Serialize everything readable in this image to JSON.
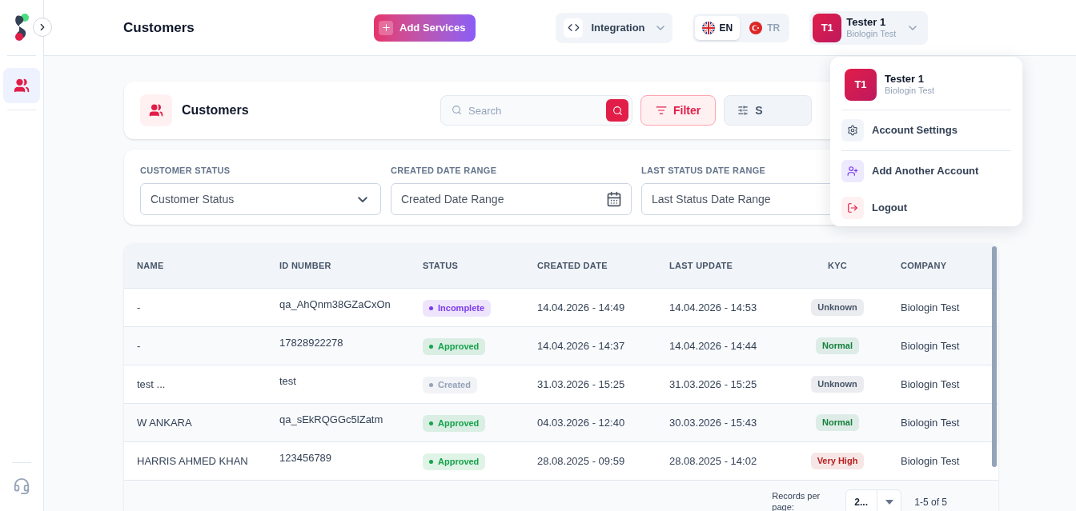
{
  "header": {
    "title": "Customers",
    "add_services": "Add Services",
    "integration": "Integration",
    "languages": [
      {
        "code": "EN",
        "selected": true
      },
      {
        "code": "TR",
        "selected": false
      }
    ],
    "user": {
      "initials": "T1",
      "name": "Tester 1",
      "company": "Biologin Test"
    }
  },
  "sidebar": {
    "items": [
      {
        "kind": "customers",
        "selected": true
      }
    ]
  },
  "page_card": {
    "title": "Customers",
    "search_placeholder": "Search",
    "filter": "Filter",
    "settings_button": "S"
  },
  "filters": [
    {
      "label": "CUSTOMER STATUS",
      "placeholder": "Customer Status",
      "kind": "select"
    },
    {
      "label": "CREATED DATE RANGE",
      "placeholder": "Created Date Range",
      "kind": "date"
    },
    {
      "label": "LAST STATUS DATE RANGE",
      "placeholder": "Last Status Date Range",
      "kind": "text"
    }
  ],
  "table": {
    "columns": [
      "NAME",
      "ID NUMBER",
      "STATUS",
      "CREATED DATE",
      "LAST UPDATE",
      "KYC",
      "COMPANY"
    ],
    "rows": [
      {
        "name": "-",
        "id": "qa_AhQnm38GZaCxOn",
        "status": {
          "text": "Incomplete",
          "color": "#7c3aed"
        },
        "created": "14.04.2026 - 14:49",
        "updated": "14.04.2026 - 14:53",
        "kyc": {
          "text": "Unknown",
          "color": "#475569"
        },
        "company": "Biologin Test"
      },
      {
        "name": "-",
        "id": "17828922278",
        "status": {
          "text": "Approved",
          "color": "#16a34a"
        },
        "created": "14.04.2026 - 14:37",
        "updated": "14.04.2026 - 14:44",
        "kyc": {
          "text": "Normal",
          "color": "#15803d"
        },
        "company": "Biologin Test"
      },
      {
        "name": "test ...",
        "id": "test",
        "status": {
          "text": "Created",
          "color": "#94a3b8"
        },
        "created": "31.03.2026 - 15:25",
        "updated": "31.03.2026 - 15:25",
        "kyc": {
          "text": "Unknown",
          "color": "#475569"
        },
        "company": "Biologin Test"
      },
      {
        "name": "W ANKARA",
        "id": "qa_sEkRQGGc5lZatm",
        "status": {
          "text": "Approved",
          "color": "#16a34a"
        },
        "created": "04.03.2026 - 12:40",
        "updated": "30.03.2026 - 15:43",
        "kyc": {
          "text": "Normal",
          "color": "#15803d"
        },
        "company": "Biologin Test"
      },
      {
        "name": "HARRIS AHMED KHAN",
        "id": "123456789",
        "status": {
          "text": "Approved",
          "color": "#16a34a"
        },
        "created": "28.08.2025 - 09:59",
        "updated": "28.08.2025 - 14:02",
        "kyc": {
          "text": "Very High",
          "color": "#b91c1c"
        },
        "company": "Biologin Test"
      }
    ],
    "records_label": "Records per page:",
    "page_size": "2...",
    "range": "1-5 of 5"
  },
  "user_menu": {
    "initials": "T1",
    "name": "Tester 1",
    "company": "Biologin Test",
    "items": [
      {
        "kind": "settings",
        "label": "Account Settings"
      },
      {
        "kind": "add",
        "label": "Add Another Account"
      },
      {
        "kind": "logout",
        "label": "Logout"
      }
    ]
  }
}
